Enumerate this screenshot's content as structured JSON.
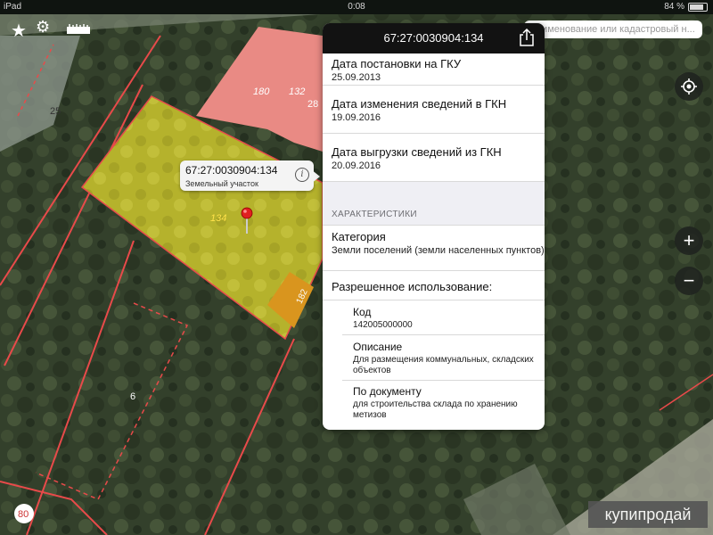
{
  "status": {
    "left": "iPad",
    "time": "0:08",
    "battery": "84 %",
    "battery_level": 0.84
  },
  "search": {
    "placeholder": "Наименование или кадастровый н..."
  },
  "map": {
    "labels": [
      "25",
      "180",
      "132",
      "28",
      "134",
      "182",
      "6",
      "80"
    ]
  },
  "callout": {
    "title": "67:27:0030904:134",
    "subtitle": "Земельный участок",
    "info": "i"
  },
  "panel": {
    "title": "67:27:0030904:134",
    "rows": [
      {
        "label": "Дата постановки на ГКУ",
        "value": "25.09.2013"
      },
      {
        "label": "Дата изменения сведений в ГКН",
        "value": "19.09.2016"
      },
      {
        "label": "Дата выгрузки сведений из ГКН",
        "value": "20.09.2016"
      }
    ],
    "section": "ХАРАКТЕРИСТИКИ",
    "category": {
      "label": "Категория",
      "value": "Земли поселений (земли населенных пунктов)"
    },
    "permitted_use": {
      "label": "Разрешенное использование:"
    },
    "code": {
      "label": "Код",
      "value": "142005000000"
    },
    "description": {
      "label": "Описание",
      "value": "Для размещения коммунальных, складских объектов"
    },
    "by_document": {
      "label": "По документу",
      "value": "для строительства склада по хранению метизов"
    }
  },
  "watermark": "купипродай",
  "colors": {
    "parcel": "#b7b52a",
    "building": "#e98a84",
    "boundary": "#e84a4a"
  }
}
